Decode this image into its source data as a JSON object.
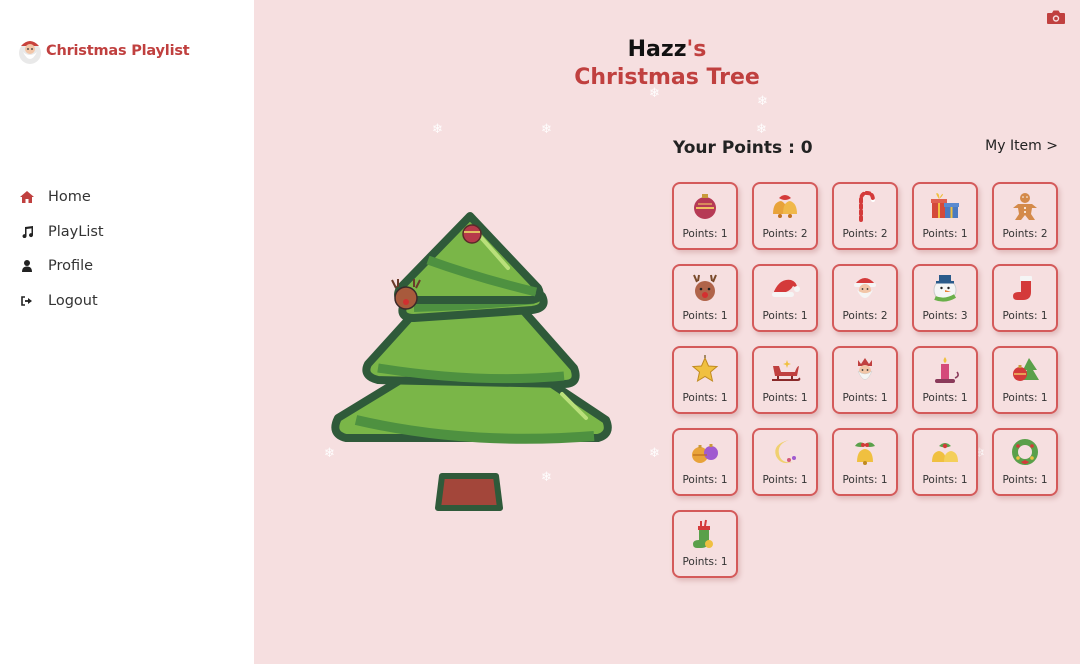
{
  "app": {
    "title": "Christmas Playlist"
  },
  "sidebar": {
    "items": [
      {
        "label": "Home",
        "icon": "home-icon",
        "active": true
      },
      {
        "label": "PlayList",
        "icon": "music-note-icon",
        "active": false
      },
      {
        "label": "Profile",
        "icon": "user-icon",
        "active": false
      },
      {
        "label": "Logout",
        "icon": "logout-icon",
        "active": false
      }
    ]
  },
  "header": {
    "owner": "Hazz",
    "possessive": "'s",
    "title": "Christmas Tree"
  },
  "points": {
    "label": "Your Points : 0",
    "my_item_label": "My Item >"
  },
  "items": [
    {
      "icon": "bauble-icon",
      "points_label": "Points: 1"
    },
    {
      "icon": "bells-icon",
      "points_label": "Points: 2"
    },
    {
      "icon": "candy-cane-icon",
      "points_label": "Points: 2"
    },
    {
      "icon": "gift-boxes-icon",
      "points_label": "Points: 1"
    },
    {
      "icon": "gingerbread-man-icon",
      "points_label": "Points: 2"
    },
    {
      "icon": "reindeer-icon",
      "points_label": "Points: 1"
    },
    {
      "icon": "santa-hat-icon",
      "points_label": "Points: 1"
    },
    {
      "icon": "santa-face-icon",
      "points_label": "Points: 2"
    },
    {
      "icon": "snowman-icon",
      "points_label": "Points: 3"
    },
    {
      "icon": "stocking-icon",
      "points_label": "Points: 1"
    },
    {
      "icon": "star-icon",
      "points_label": "Points: 1"
    },
    {
      "icon": "sleigh-icon",
      "points_label": "Points: 1"
    },
    {
      "icon": "king-face-icon",
      "points_label": "Points: 1"
    },
    {
      "icon": "candle-icon",
      "points_label": "Points: 1"
    },
    {
      "icon": "tree-ornament-icon",
      "points_label": "Points: 1"
    },
    {
      "icon": "ornaments-icon",
      "points_label": "Points: 1"
    },
    {
      "icon": "moon-icon",
      "points_label": "Points: 1"
    },
    {
      "icon": "holly-bell-icon",
      "points_label": "Points: 1"
    },
    {
      "icon": "jingle-bells-icon",
      "points_label": "Points: 1"
    },
    {
      "icon": "wreath-icon",
      "points_label": "Points: 1"
    },
    {
      "icon": "gift-stocking-icon",
      "points_label": "Points: 1"
    }
  ],
  "colors": {
    "accent": "#c0403f",
    "background": "#f6dfe0",
    "card_border": "#d45a5a",
    "tree_green": "#7ab648",
    "tree_outline": "#2f5a3a",
    "trunk": "#a3463a"
  }
}
